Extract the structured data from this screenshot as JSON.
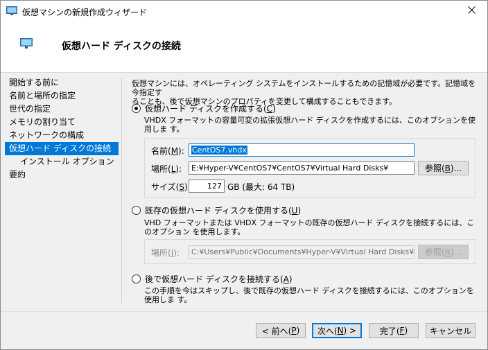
{
  "window": {
    "title": "仮想マシンの新規作成ウィザード"
  },
  "header": {
    "title": "仮想ハード ディスクの接続"
  },
  "nav": {
    "items": [
      {
        "label": "開始する前に"
      },
      {
        "label": "名前と場所の指定"
      },
      {
        "label": "世代の指定"
      },
      {
        "label": "メモリの割り当て"
      },
      {
        "label": "ネットワークの構成"
      },
      {
        "label": "仮想ハード ディスクの接続"
      },
      {
        "label": "インストール オプション"
      },
      {
        "label": "要約"
      }
    ]
  },
  "content": {
    "intro_line1": "仮想マシンには、オペレーティング システムをインストールするための記憶域が必要です。記憶域を今指定す",
    "intro_line2": "ることも、後で仮想マシンのプロパティを変更して構成することもできます。",
    "option_create": {
      "label": "仮想ハード ディスクを作成する(",
      "accel": "C",
      "desc": "VHDX フォーマットの容量可変の拡張仮想ハード ディスクを作成するには、このオプションを使用しま す。",
      "name_label": "名前(",
      "name_accel": "M",
      "name_value": "CentOS7.vhdx",
      "location_label": "場所(",
      "location_accel": "L",
      "location_value": "E:¥Hyper-V¥CentOS7¥CentOS7¥Virtual Hard Disks¥",
      "browse_label": "参照(",
      "browse_accel": "B",
      "size_label": "サイズ(",
      "size_accel": "S",
      "size_value": "127",
      "size_unit": "GB (最大: 64 TB)"
    },
    "option_existing": {
      "label": "既存の仮想ハード ディスクを使用する(",
      "accel": "U",
      "desc": "VHD フォーマットまたは VHDX フォーマットの既存の仮想ハード ディスクを接続するには、このオプション を使用します。",
      "location_label": "場所(",
      "location_accel": "I",
      "location_value": "C:¥Users¥Public¥Documents¥Hyper-V¥Virtual Hard Disks¥",
      "browse_label": "参照(",
      "browse_accel": "R"
    },
    "option_later": {
      "label": "後で仮想ハード ディスクを接続する(",
      "accel": "A",
      "desc": "この手順を今はスキップし、後で既存の仮想ハード ディスクを接続するには、このオプションを使用しま す。"
    }
  },
  "footer": {
    "prev_label": "< 前へ(",
    "prev_accel": "P",
    "next_label": "次へ(",
    "next_accel": "N",
    "next_suffix": ") >",
    "finish_label": "完了(",
    "finish_accel": "F",
    "cancel_label": "キャンセル"
  },
  "colors": {
    "accent": "#0078d7"
  }
}
